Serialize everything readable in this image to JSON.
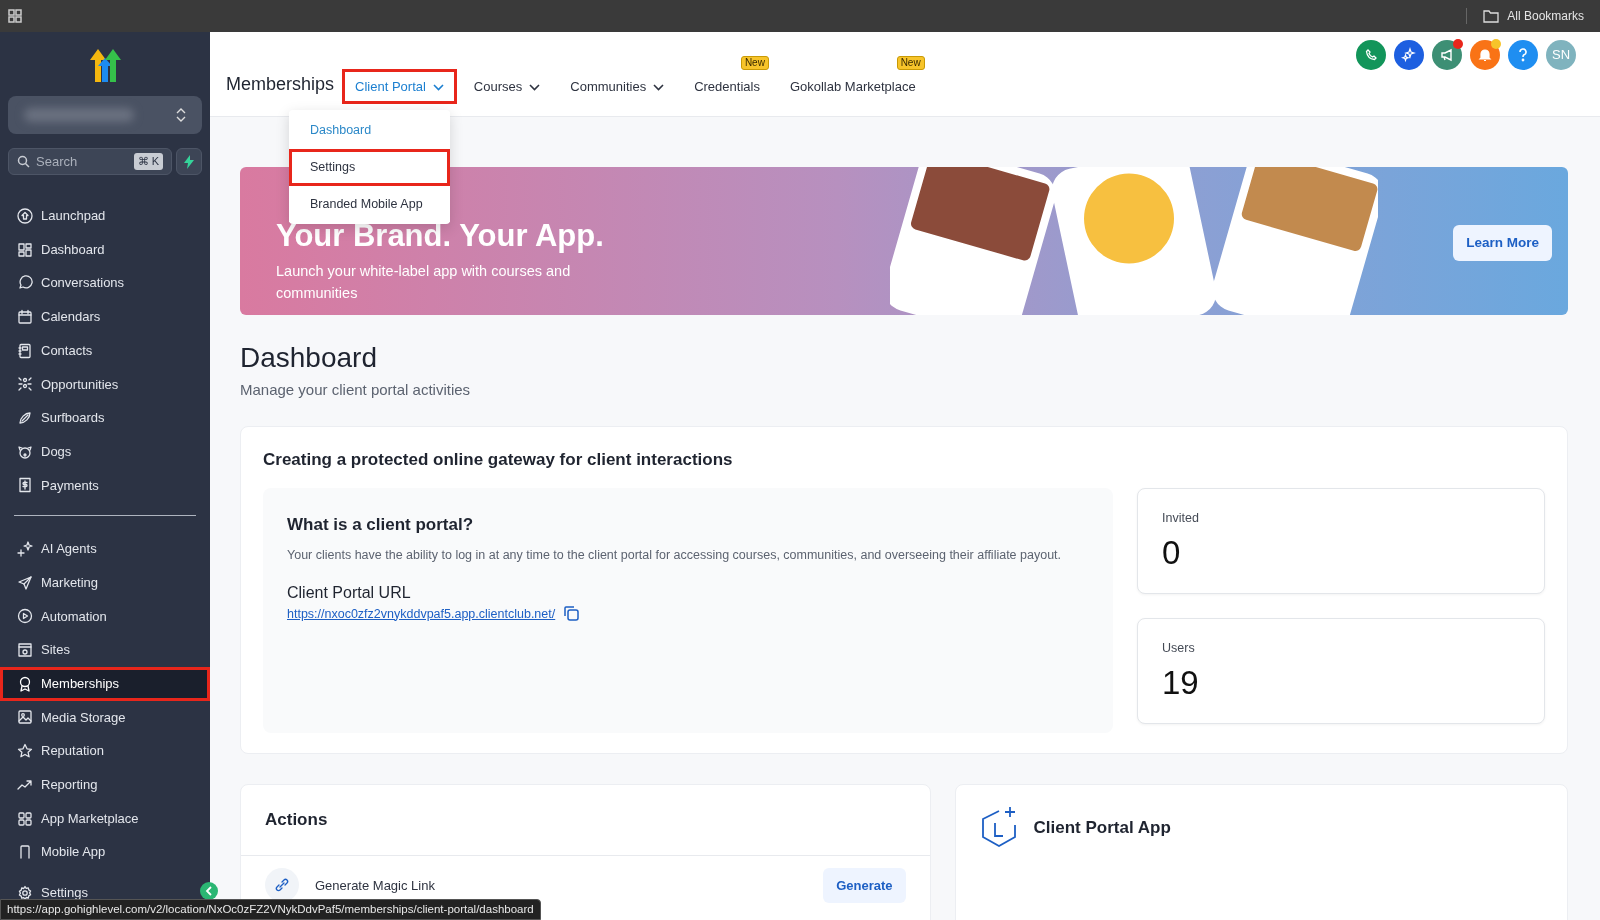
{
  "browser_bar": {
    "bookmarks_label": "All Bookmarks"
  },
  "sidebar": {
    "search": {
      "placeholder": "Search",
      "shortcut": "⌘ K"
    },
    "groups": [
      {
        "items": [
          {
            "label": "Launchpad",
            "selected": false,
            "annotated": false
          },
          {
            "label": "Dashboard",
            "selected": false,
            "annotated": false
          },
          {
            "label": "Conversations",
            "selected": false,
            "annotated": false
          },
          {
            "label": "Calendars",
            "selected": false,
            "annotated": false
          },
          {
            "label": "Contacts",
            "selected": false,
            "annotated": false
          },
          {
            "label": "Opportunities",
            "selected": false,
            "annotated": false
          },
          {
            "label": "Surfboards",
            "selected": false,
            "annotated": false
          },
          {
            "label": "Dogs",
            "selected": false,
            "annotated": false
          },
          {
            "label": "Payments",
            "selected": false,
            "annotated": false
          }
        ]
      },
      {
        "items": [
          {
            "label": "AI Agents",
            "selected": false,
            "annotated": false
          },
          {
            "label": "Marketing",
            "selected": false,
            "annotated": false
          },
          {
            "label": "Automation",
            "selected": false,
            "annotated": false
          },
          {
            "label": "Sites",
            "selected": false,
            "annotated": false
          },
          {
            "label": "Memberships",
            "selected": true,
            "annotated": true
          },
          {
            "label": "Media Storage",
            "selected": false,
            "annotated": false
          },
          {
            "label": "Reputation",
            "selected": false,
            "annotated": false
          },
          {
            "label": "Reporting",
            "selected": false,
            "annotated": false
          },
          {
            "label": "App Marketplace",
            "selected": false,
            "annotated": false
          },
          {
            "label": "Mobile App",
            "selected": false,
            "annotated": false
          }
        ]
      }
    ],
    "footer_item": {
      "label": "Settings"
    }
  },
  "header": {
    "title": "Memberships",
    "tabs": [
      {
        "label": "Client Portal",
        "selected": true,
        "dropdown": true,
        "annotated": true
      },
      {
        "label": "Courses",
        "selected": false,
        "dropdown": true,
        "annotated": false
      },
      {
        "label": "Communities",
        "selected": false,
        "dropdown": true,
        "annotated": false
      },
      {
        "label": "Credentials",
        "selected": false,
        "dropdown": false,
        "annotated": false,
        "badge": "New"
      },
      {
        "label": "Gokollab Marketplace",
        "selected": false,
        "dropdown": false,
        "annotated": false,
        "badge": "New"
      }
    ],
    "menu": [
      {
        "label": "Dashboard",
        "selected": true,
        "annotated": false
      },
      {
        "label": "Settings",
        "selected": false,
        "annotated": true
      },
      {
        "label": "Branded Mobile App",
        "selected": false,
        "annotated": false
      }
    ],
    "avatar": "SN"
  },
  "banner": {
    "title": "Your Brand. Your App.",
    "text": "Launch your white-label app with courses and communities",
    "button": "Learn More"
  },
  "page": {
    "title": "Dashboard",
    "subtitle": "Manage your client portal activities"
  },
  "overview": {
    "heading": "Creating a protected online gateway for client interactions",
    "info": {
      "title": "What is a client portal?",
      "text": "Your clients have the ability to log in at any time to the client portal for accessing courses, communities, and overseeing their affiliate payout.",
      "url_label": "Client Portal URL",
      "url": "https://nxoc0zfz2vnykddvpaf5.app.clientclub.net/"
    },
    "stats": [
      {
        "label": "Invited",
        "value": "0"
      },
      {
        "label": "Users",
        "value": "19"
      }
    ]
  },
  "actions": {
    "title": "Actions",
    "rows": [
      {
        "label": "Generate Magic Link",
        "button": "Generate"
      }
    ]
  },
  "app_card": {
    "title": "Client Portal App"
  },
  "status_bar": {
    "url": "https://app.gohighlevel.com/v2/location/NxOc0zFZ2VNykDdvPaf5/memberships/client-portal/dashboard"
  }
}
